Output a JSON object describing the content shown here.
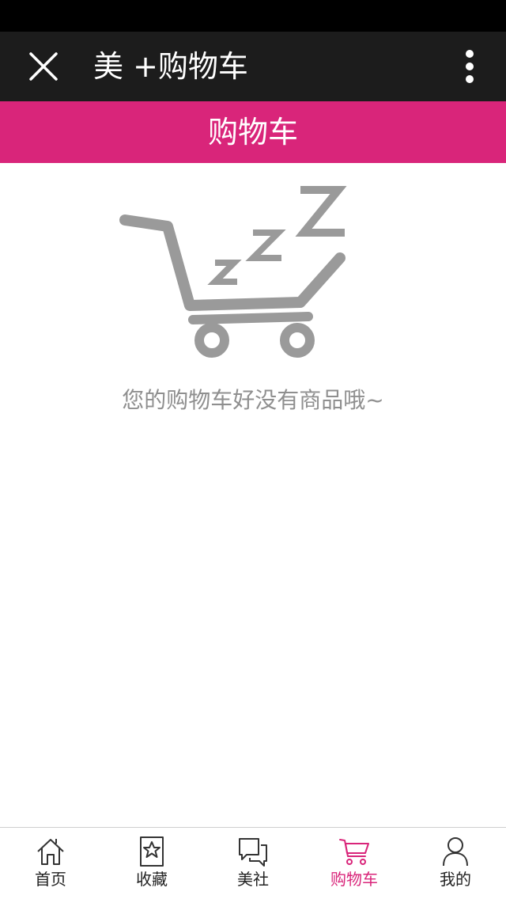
{
  "app_bar": {
    "title": "美 +购物车",
    "close_icon": "close-icon",
    "more_icon": "more-vertical-icon"
  },
  "header": {
    "title": "购物车",
    "color": "#d9257a"
  },
  "empty_state": {
    "icon": "sleeping-cart-icon",
    "message": "您的购物车好没有商品哦~"
  },
  "tab_bar": {
    "active_color": "#d9257a",
    "tabs": [
      {
        "label": "首页",
        "icon": "home-icon",
        "active": false
      },
      {
        "label": "收藏",
        "icon": "bookmark-star-icon",
        "active": false
      },
      {
        "label": "美社",
        "icon": "chat-bubbles-icon",
        "active": false
      },
      {
        "label": "购物车",
        "icon": "cart-icon",
        "active": true
      },
      {
        "label": "我的",
        "icon": "person-icon",
        "active": false
      }
    ]
  }
}
